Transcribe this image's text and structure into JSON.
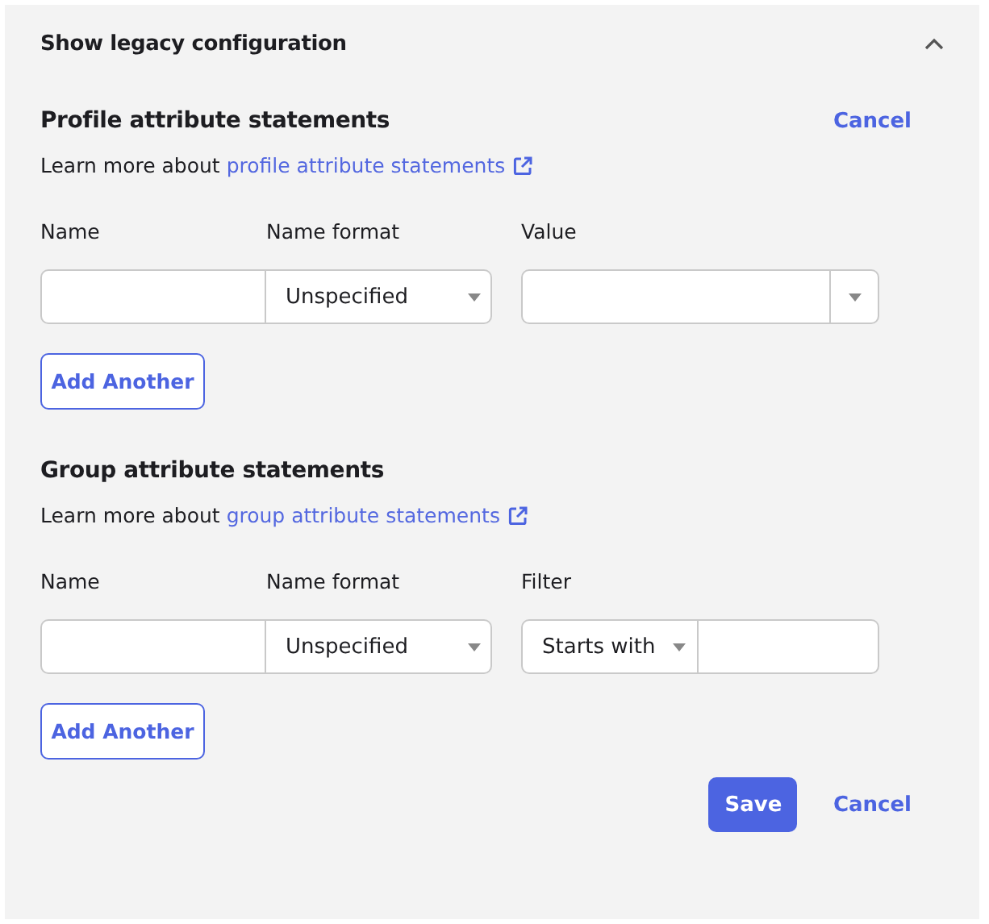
{
  "legacy": {
    "title": "Show legacy configuration",
    "expanded": true
  },
  "sections": [
    {
      "heading": "Profile attribute statements",
      "cancel": "Cancel",
      "learn_prefix": "Learn more about ",
      "learn_link": "profile attribute statements",
      "columns": [
        "Name",
        "Name format",
        "Value"
      ],
      "row": {
        "name_format": "Unspecified",
        "third": {
          "kind": "combo"
        }
      },
      "add": "Add Another"
    },
    {
      "heading": "Group attribute statements",
      "learn_prefix": "Learn more about ",
      "learn_link": "group attribute statements",
      "columns": [
        "Name",
        "Name format",
        "Filter"
      ],
      "row": {
        "name_format": "Unspecified",
        "third": {
          "kind": "filter",
          "option": "Starts with"
        }
      },
      "add": "Add Another"
    }
  ],
  "footer": {
    "save": "Save",
    "cancel": "Cancel"
  }
}
